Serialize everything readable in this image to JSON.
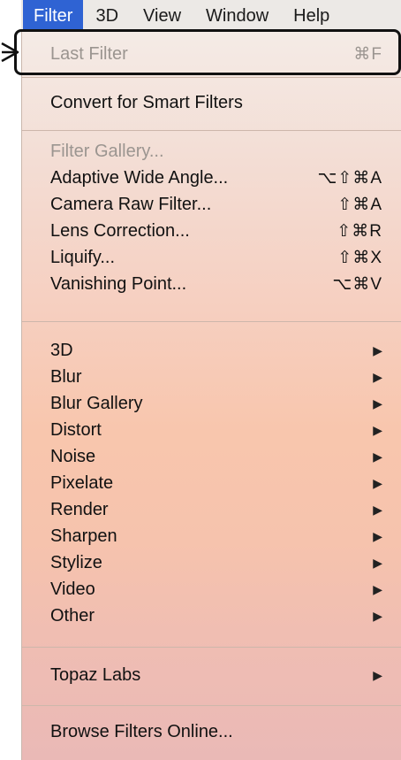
{
  "menubar": {
    "items": [
      "Filter",
      "3D",
      "View",
      "Window",
      "Help"
    ],
    "active_index": 0
  },
  "menu": {
    "last_filter": {
      "label": "Last Filter",
      "shortcut": "⌘F"
    },
    "convert": {
      "label": "Convert for Smart Filters"
    },
    "filter_gallery": {
      "label": "Filter Gallery..."
    },
    "adaptive_wide_angle": {
      "label": "Adaptive Wide Angle...",
      "shortcut": "⌥⇧⌘A"
    },
    "camera_raw": {
      "label": "Camera Raw Filter...",
      "shortcut": "⇧⌘A"
    },
    "lens_correction": {
      "label": "Lens Correction...",
      "shortcut": "⇧⌘R"
    },
    "liquify": {
      "label": "Liquify...",
      "shortcut": "⇧⌘X"
    },
    "vanishing_point": {
      "label": "Vanishing Point...",
      "shortcut": "⌥⌘V"
    },
    "submenus": [
      "3D",
      "Blur",
      "Blur Gallery",
      "Distort",
      "Noise",
      "Pixelate",
      "Render",
      "Sharpen",
      "Stylize",
      "Video",
      "Other"
    ],
    "topaz": {
      "label": "Topaz Labs"
    },
    "browse_online": {
      "label": "Browse Filters Online..."
    },
    "submenu_arrow": "▶"
  }
}
